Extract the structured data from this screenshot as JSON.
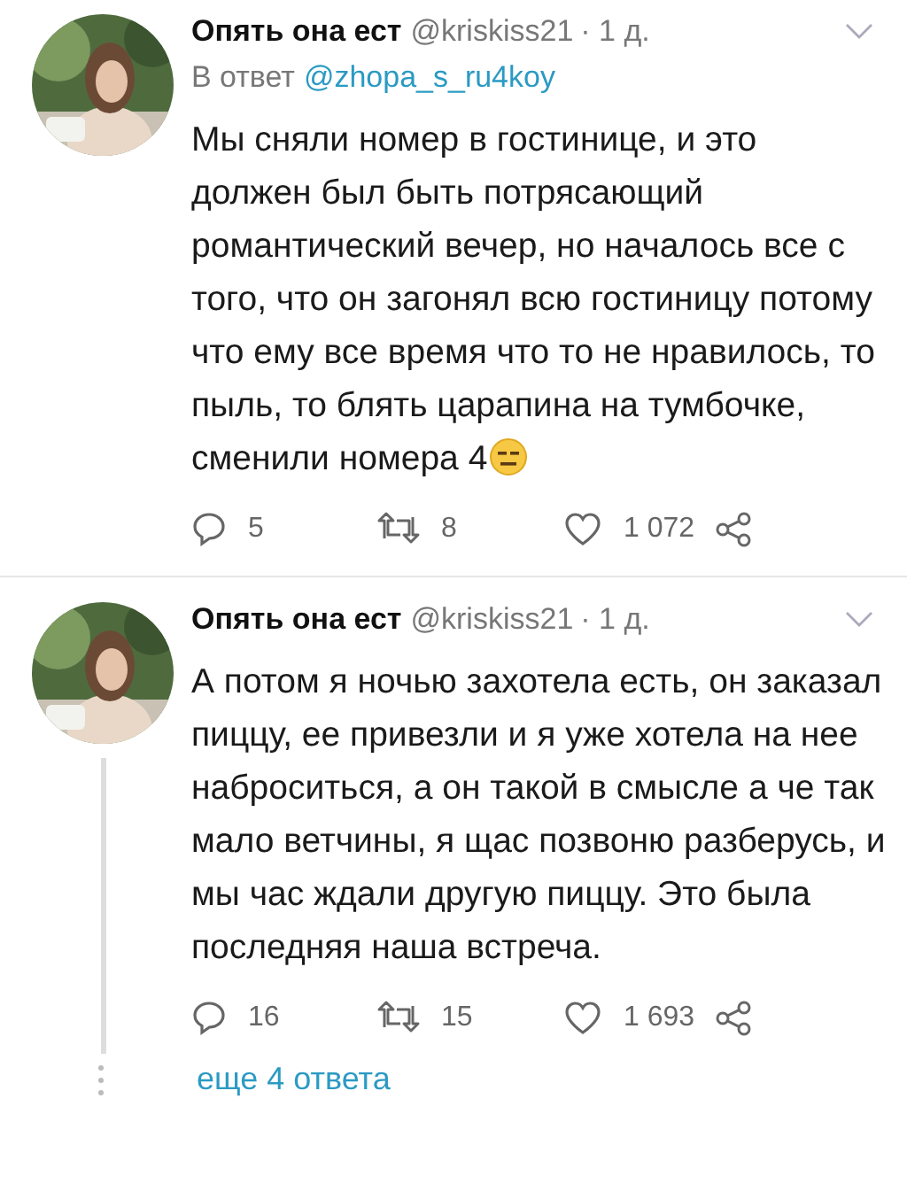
{
  "tweets": [
    {
      "author": "Опять она ест",
      "handle": "@kriskiss21",
      "time": "· 1 д.",
      "reply_to_label": "В ответ",
      "reply_to": "@zhopa_s_ru4koy",
      "text": "Мы сняли номер в гостинице, и это должен был быть потрясающий романтический вечер, но началось все с того, что он загонял всю гостиницу потому что ему все время что то не нравилось, то пыль, то блять царапина на тумбочке, сменили номера 4",
      "ends_with_emoji": true,
      "replies": "5",
      "retweets": "8",
      "likes": "1 072",
      "thread_line": false
    },
    {
      "author": "Опять она ест",
      "handle": "@kriskiss21",
      "time": "· 1 д.",
      "text": "А потом я ночью захотела есть, он заказал пиццу, ее привезли и я уже хотела на нее наброситься, а он такой в смысле а че так мало ветчины, я щас позвоню разберусь, и мы час ждали другую пиццу. Это была последняя наша встреча.",
      "replies": "16",
      "retweets": "15",
      "likes": "1 693",
      "thread_line": true
    }
  ],
  "more_replies": "еще 4 ответа"
}
